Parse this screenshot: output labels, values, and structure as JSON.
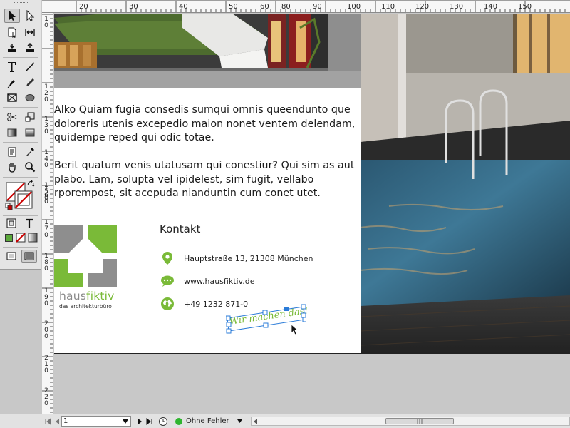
{
  "ruler_top": {
    "labels": [
      "20",
      "30",
      "40",
      "50",
      "60",
      "70",
      "80",
      "90",
      "100",
      "110",
      "120",
      "130",
      "140",
      "150"
    ]
  },
  "ruler_left": {
    "labels": [
      "10",
      "120",
      "130",
      "140",
      "150",
      "160",
      "170",
      "180",
      "190",
      "200",
      "210",
      "220"
    ]
  },
  "page": {
    "paragraph_1": "Alko Quiam fugia consedis sumqui omnis queendunto que doloreris utenis excepedio maion nonet ventem delendam, quidempe reped qui odic totae.",
    "paragraph_2": "Berit quatum venis utatusam qui conestiur? Qui sim as aut plabo. Lam, solupta vel ipidelest, sim fugit, vellabo rporempost, sit acepuda nianduntin cum conet utet.",
    "brand": {
      "name_part1": "haus",
      "name_part2": "fiktiv",
      "tagline": "das architekturbüro"
    },
    "contact": {
      "title": "Kontakt",
      "address": "Hauptstraße 13, 21308 München",
      "website": "www.hausfiktiv.de",
      "phone": "+49 1232 871-0"
    },
    "slogan": "Wir machen das!"
  },
  "statusbar": {
    "page_number": "1",
    "preflight_status": "Ohne Fehler"
  },
  "colors": {
    "brand_green": "#7aba38",
    "brand_gray": "#8a8a8a",
    "selection_blue": "#2a7bd8"
  },
  "icons": [
    "selection-tool-icon",
    "direct-selection-tool-icon",
    "page-tool-icon",
    "gap-tool-icon",
    "content-collector-icon",
    "content-placer-icon",
    "type-tool-icon",
    "line-tool-icon",
    "pen-tool-icon",
    "pencil-tool-icon",
    "rectangle-frame-tool-icon",
    "ellipse-tool-icon",
    "scissors-tool-icon",
    "free-transform-tool-icon",
    "gradient-swatch-tool-icon",
    "gradient-feather-tool-icon",
    "note-tool-icon",
    "eyedropper-tool-icon",
    "hand-tool-icon",
    "zoom-tool-icon",
    "fill-stroke-icon",
    "swap-icon",
    "location-pin-icon",
    "speech-bubble-icon",
    "globe-icon"
  ]
}
